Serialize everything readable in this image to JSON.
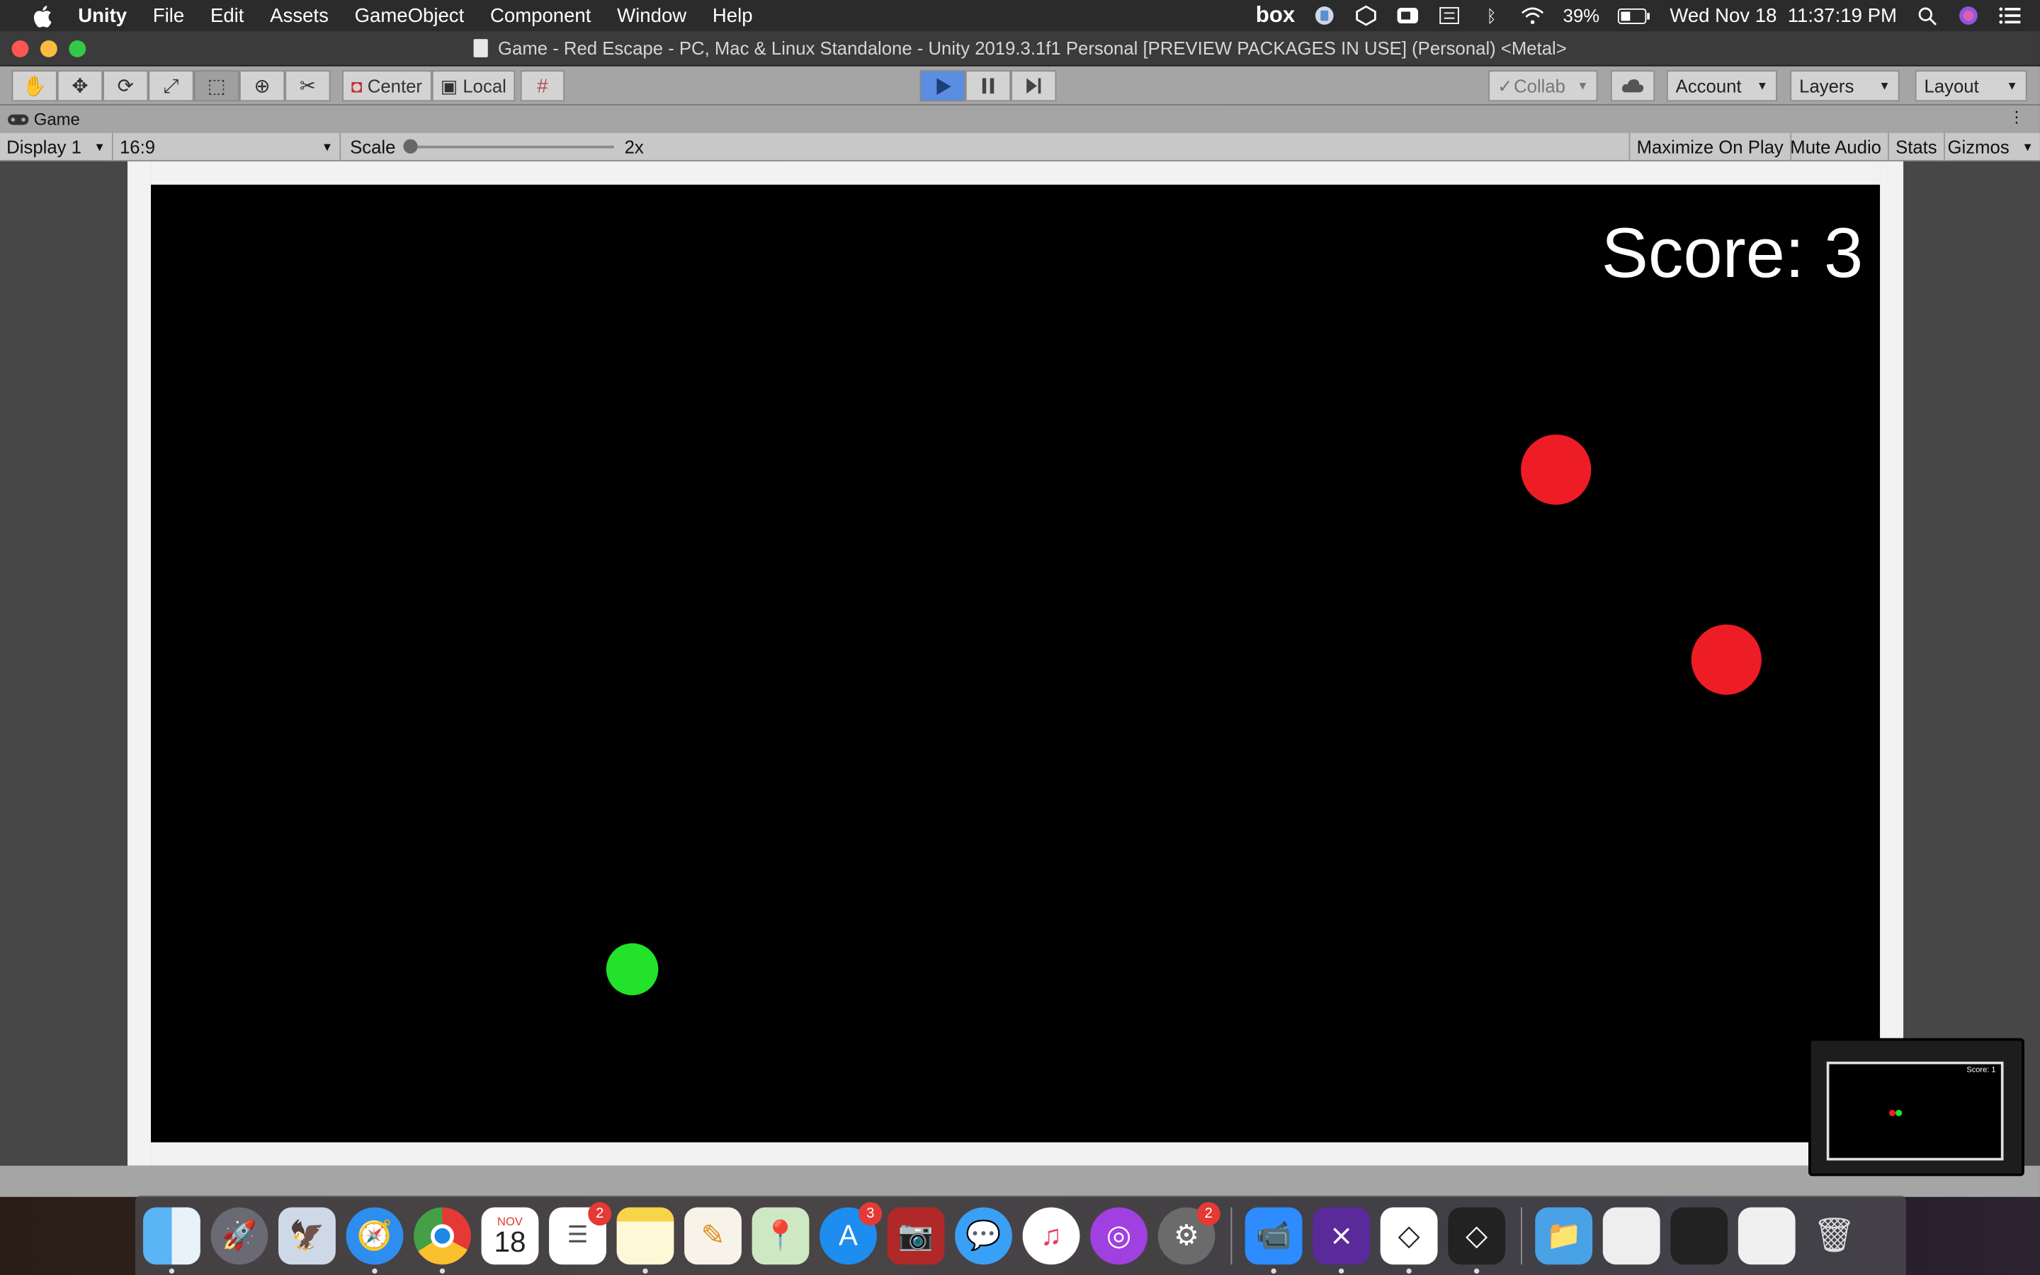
{
  "menubar": {
    "app_name": "Unity",
    "items": [
      "File",
      "Edit",
      "Assets",
      "GameObject",
      "Component",
      "Window",
      "Help"
    ],
    "right": {
      "box_label": "box",
      "battery": "39%",
      "datetime": "Wed Nov 18  11:37:19 PM"
    }
  },
  "window": {
    "title": "Game - Red Escape - PC, Mac & Linux Standalone - Unity 2019.3.1f1 Personal [PREVIEW PACKAGES IN USE] (Personal) <Metal>"
  },
  "toolbar": {
    "pivot_label": "Center",
    "space_label": "Local",
    "collab_label": "Collab",
    "account_label": "Account",
    "layers_label": "Layers",
    "layout_label": "Layout"
  },
  "tab": {
    "label": "Game"
  },
  "game_toolbar": {
    "display": "Display 1",
    "aspect": "16:9",
    "scale_label": "Scale",
    "scale_value": "2x",
    "maximize_on_play": "Maximize On Play",
    "mute_audio": "Mute Audio",
    "stats": "Stats",
    "gizmos": "Gizmos"
  },
  "game": {
    "score_text": "Score: 3",
    "enemy_color": "#ee1c24",
    "player_color": "#22e22a"
  },
  "dock": {
    "calendar_month": "NOV",
    "calendar_day": "18",
    "reminders_badge": "2",
    "appstore_badge": "3",
    "prefs_badge": "2"
  },
  "thumbnail": {
    "score_text": "Score: 1"
  },
  "colors": {
    "menubar_bg": "#2b2b2b",
    "toolbar_bg": "#a5a5a5",
    "play_active": "#5b8de0"
  }
}
